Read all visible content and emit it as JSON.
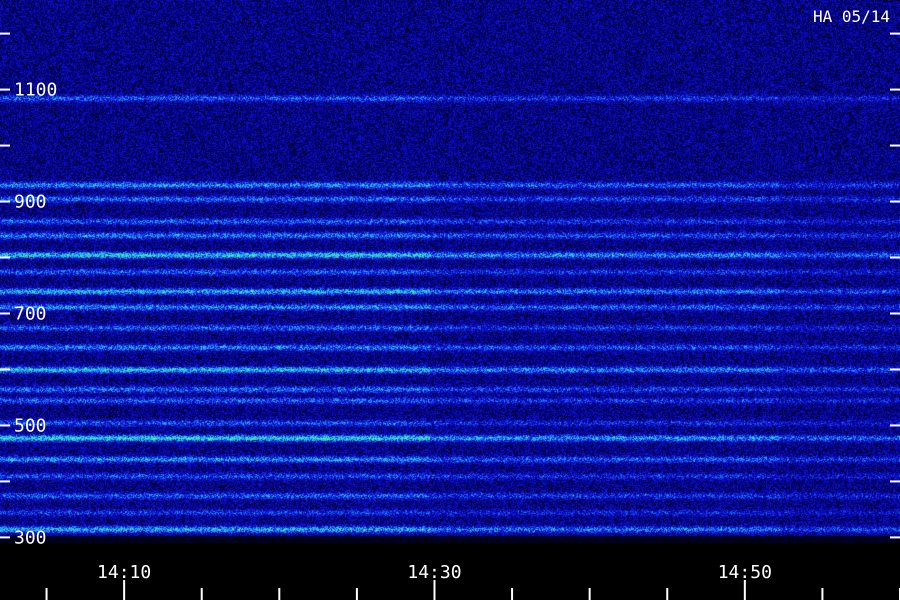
{
  "chart_data": {
    "type": "heatmap",
    "title": "HA 05/14",
    "xlabel": "",
    "ylabel": "",
    "x": {
      "ticks": [
        "14:10",
        "14:30",
        "14:50"
      ],
      "tick_minutes": [
        10,
        30,
        50
      ],
      "range_minutes": [
        2,
        60
      ],
      "minor_step_minutes": 5
    },
    "y": {
      "ticks": [
        "300",
        "500",
        "700",
        "900",
        "1100"
      ],
      "tick_values": [
        300,
        500,
        700,
        900,
        1100
      ],
      "range": [
        290,
        1260
      ],
      "minor_step": 100
    },
    "bands": [
      {
        "value": 315,
        "intensity": 0.7
      },
      {
        "value": 345,
        "intensity": 0.35
      },
      {
        "value": 375,
        "intensity": 0.45
      },
      {
        "value": 410,
        "intensity": 0.4
      },
      {
        "value": 440,
        "intensity": 0.6
      },
      {
        "value": 478,
        "intensity": 0.85
      },
      {
        "value": 505,
        "intensity": 0.4
      },
      {
        "value": 545,
        "intensity": 0.45
      },
      {
        "value": 565,
        "intensity": 0.5
      },
      {
        "value": 600,
        "intensity": 0.75
      },
      {
        "value": 640,
        "intensity": 0.55
      },
      {
        "value": 675,
        "intensity": 0.45
      },
      {
        "value": 712,
        "intensity": 0.6
      },
      {
        "value": 740,
        "intensity": 0.7
      },
      {
        "value": 775,
        "intensity": 0.45
      },
      {
        "value": 805,
        "intensity": 0.8
      },
      {
        "value": 840,
        "intensity": 0.55
      },
      {
        "value": 865,
        "intensity": 0.45
      },
      {
        "value": 905,
        "intensity": 0.5
      },
      {
        "value": 930,
        "intensity": 0.6
      },
      {
        "value": 1085,
        "intensity": 0.45
      }
    ],
    "grid": false,
    "legend": "none",
    "colors": {
      "background": "#000000",
      "noise_low": "#0a0a7a",
      "noise_mid": "#1a1ad0",
      "band_high": "#20a0ff",
      "band_peak": "#30ff90",
      "text": "#ffffff"
    }
  }
}
